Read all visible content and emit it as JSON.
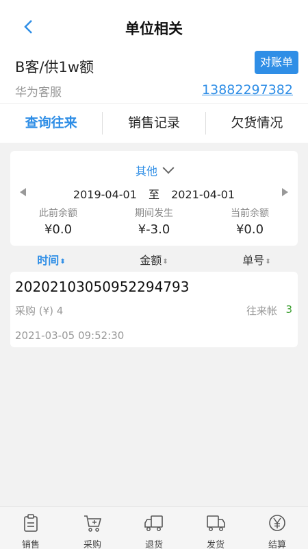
{
  "header": {
    "title": "单位相关"
  },
  "company": {
    "name": "B客/供1w额",
    "statement_button": "对账单",
    "service_name": "华为客服",
    "phone": "13882297382"
  },
  "tabs": [
    {
      "label": "查询往来",
      "active": true
    },
    {
      "label": "销售记录",
      "active": false
    },
    {
      "label": "欠货情况",
      "active": false
    }
  ],
  "summary": {
    "filter": "其他",
    "start_date": "2019-04-01",
    "range_separator": "至",
    "end_date": "2021-04-01",
    "balances": [
      {
        "label": "此前余额",
        "value": "¥0.0"
      },
      {
        "label": "期间发生",
        "value": "¥-3.0"
      },
      {
        "label": "当前余额",
        "value": "¥0.0"
      }
    ]
  },
  "sort": {
    "time": "时间",
    "amount": "金额",
    "order_no": "单号",
    "arrows": "⬍"
  },
  "records": [
    {
      "order_no": "20202103050952294793",
      "type": "采购 (¥) 4",
      "kind": "往来帐",
      "count": "3",
      "time": "2021-03-05 09:52:30"
    }
  ],
  "bottom_nav": [
    {
      "label": "销售",
      "icon": "sales-icon"
    },
    {
      "label": "采购",
      "icon": "cart-icon"
    },
    {
      "label": "退货",
      "icon": "truck-return-icon"
    },
    {
      "label": "发货",
      "icon": "truck-icon"
    },
    {
      "label": "结算",
      "icon": "yen-icon"
    }
  ],
  "colors": {
    "accent": "#2f8ee6",
    "count": "#3a9e2e"
  }
}
